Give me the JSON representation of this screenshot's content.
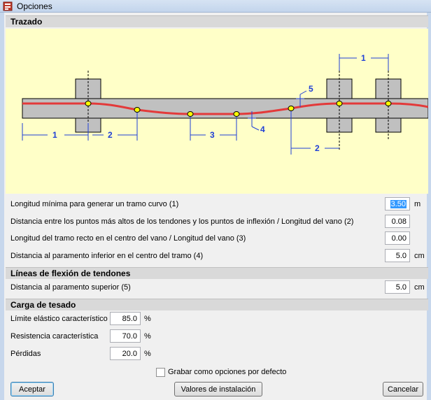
{
  "window": {
    "title": "Opciones"
  },
  "sections": {
    "trazado": "Trazado",
    "lineas_flexion": "Líneas de flexión de tendones",
    "carga_tesado": "Carga de tesado"
  },
  "diagram": {
    "labels": [
      "1",
      "2",
      "3",
      "4",
      "5",
      "2",
      "1"
    ]
  },
  "trazado_rows": [
    {
      "label": "Longitud mínima para generar un tramo curvo (1)",
      "value": "3.50",
      "unit": "m"
    },
    {
      "label": "Distancia entre los puntos más altos de los tendones y los puntos de inflexión / Longitud del vano (2)",
      "value": "0.08",
      "unit": ""
    },
    {
      "label": "Longitud del tramo recto en el centro del vano / Longitud del vano (3)",
      "value": "0.00",
      "unit": ""
    },
    {
      "label": "Distancia al paramento inferior en el centro del tramo (4)",
      "value": "5.0",
      "unit": "cm"
    }
  ],
  "flexion_rows": [
    {
      "label": "Distancia al paramento superior (5)",
      "value": "5.0",
      "unit": "cm"
    }
  ],
  "tesado_rows": [
    {
      "label": "Límite elástico característico",
      "value": "85.0",
      "unit": "%"
    },
    {
      "label": "Resistencia característica",
      "value": "70.0",
      "unit": "%"
    },
    {
      "label": "Pérdidas",
      "value": "20.0",
      "unit": "%"
    }
  ],
  "save_default": {
    "label": "Grabar como opciones por defecto",
    "checked": false
  },
  "buttons": {
    "accept": "Aceptar",
    "install_values": "Valores de instalación",
    "cancel": "Cancelar"
  },
  "colors": {
    "diagram_bg": "#ffffc8",
    "beam": "#c0c0c0",
    "tendon": "#e33a3a",
    "dimension": "#1f3fd6",
    "node": "#ffff00",
    "selection": "#3399ff"
  }
}
